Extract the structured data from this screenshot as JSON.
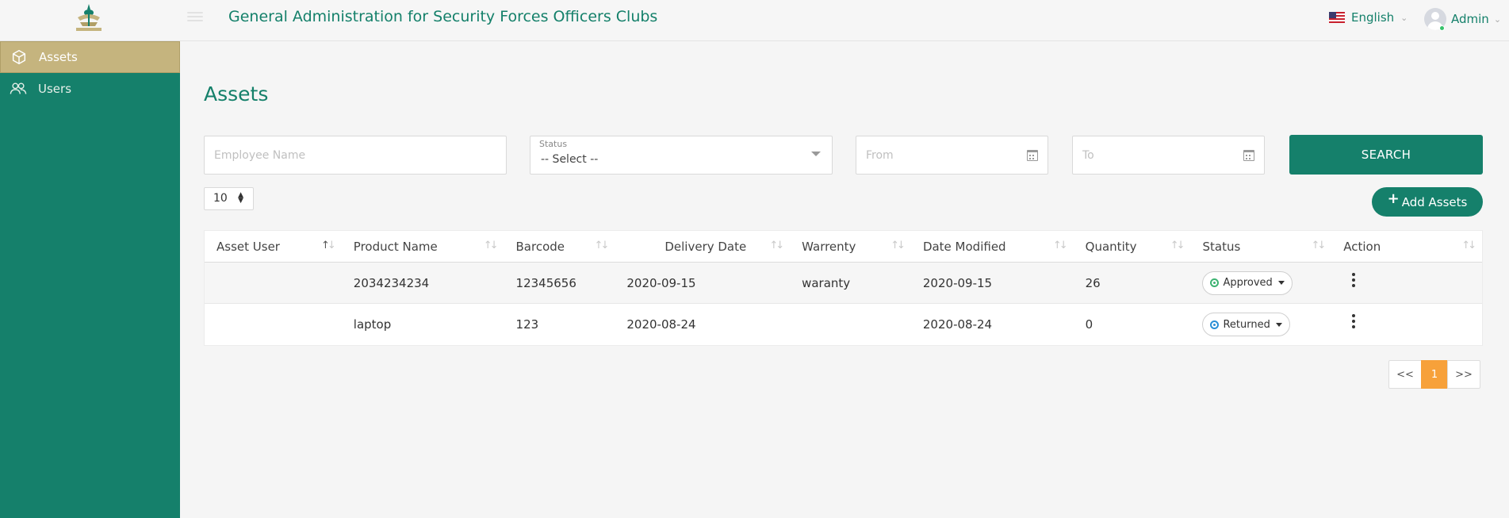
{
  "header": {
    "title": "General Administration for Security Forces Officers Clubs",
    "language": "English",
    "user_name": "Admin"
  },
  "sidebar": {
    "items": [
      {
        "label": "Assets",
        "icon": "cube-icon",
        "active": true
      },
      {
        "label": "Users",
        "icon": "users-icon",
        "active": false
      }
    ]
  },
  "main": {
    "title": "Assets",
    "filters": {
      "employee_placeholder": "Employee Name",
      "status_label": "Status",
      "status_value": "-- Select --",
      "from_placeholder": "From",
      "to_placeholder": "To",
      "search_label": "SEARCH"
    },
    "page_size": "10",
    "add_label": "Add Assets"
  },
  "table": {
    "columns": [
      "Asset User",
      "Product Name",
      "Barcode",
      "Delivery Date",
      "Warrenty",
      "Date Modified",
      "Quantity",
      "Status",
      "Action"
    ],
    "rows": [
      {
        "asset_user": "",
        "product_name": "2034234234",
        "barcode": "12345656",
        "delivery_date": "2020-09-15",
        "warrenty": "waranty",
        "date_modified": "2020-09-15",
        "quantity": "26",
        "status": "Approved",
        "status_color": "#3cb371"
      },
      {
        "asset_user": "",
        "product_name": "laptop",
        "barcode": "123",
        "delivery_date": "2020-08-24",
        "warrenty": "",
        "date_modified": "2020-08-24",
        "quantity": "0",
        "status": "Returned",
        "status_color": "#2a8fd6"
      }
    ]
  },
  "pagination": {
    "prev": "<<",
    "current": "1",
    "next": ">>"
  },
  "colors": {
    "brand": "#15806b",
    "active_nav": "#c5b47e",
    "page_active": "#f7a13a"
  }
}
